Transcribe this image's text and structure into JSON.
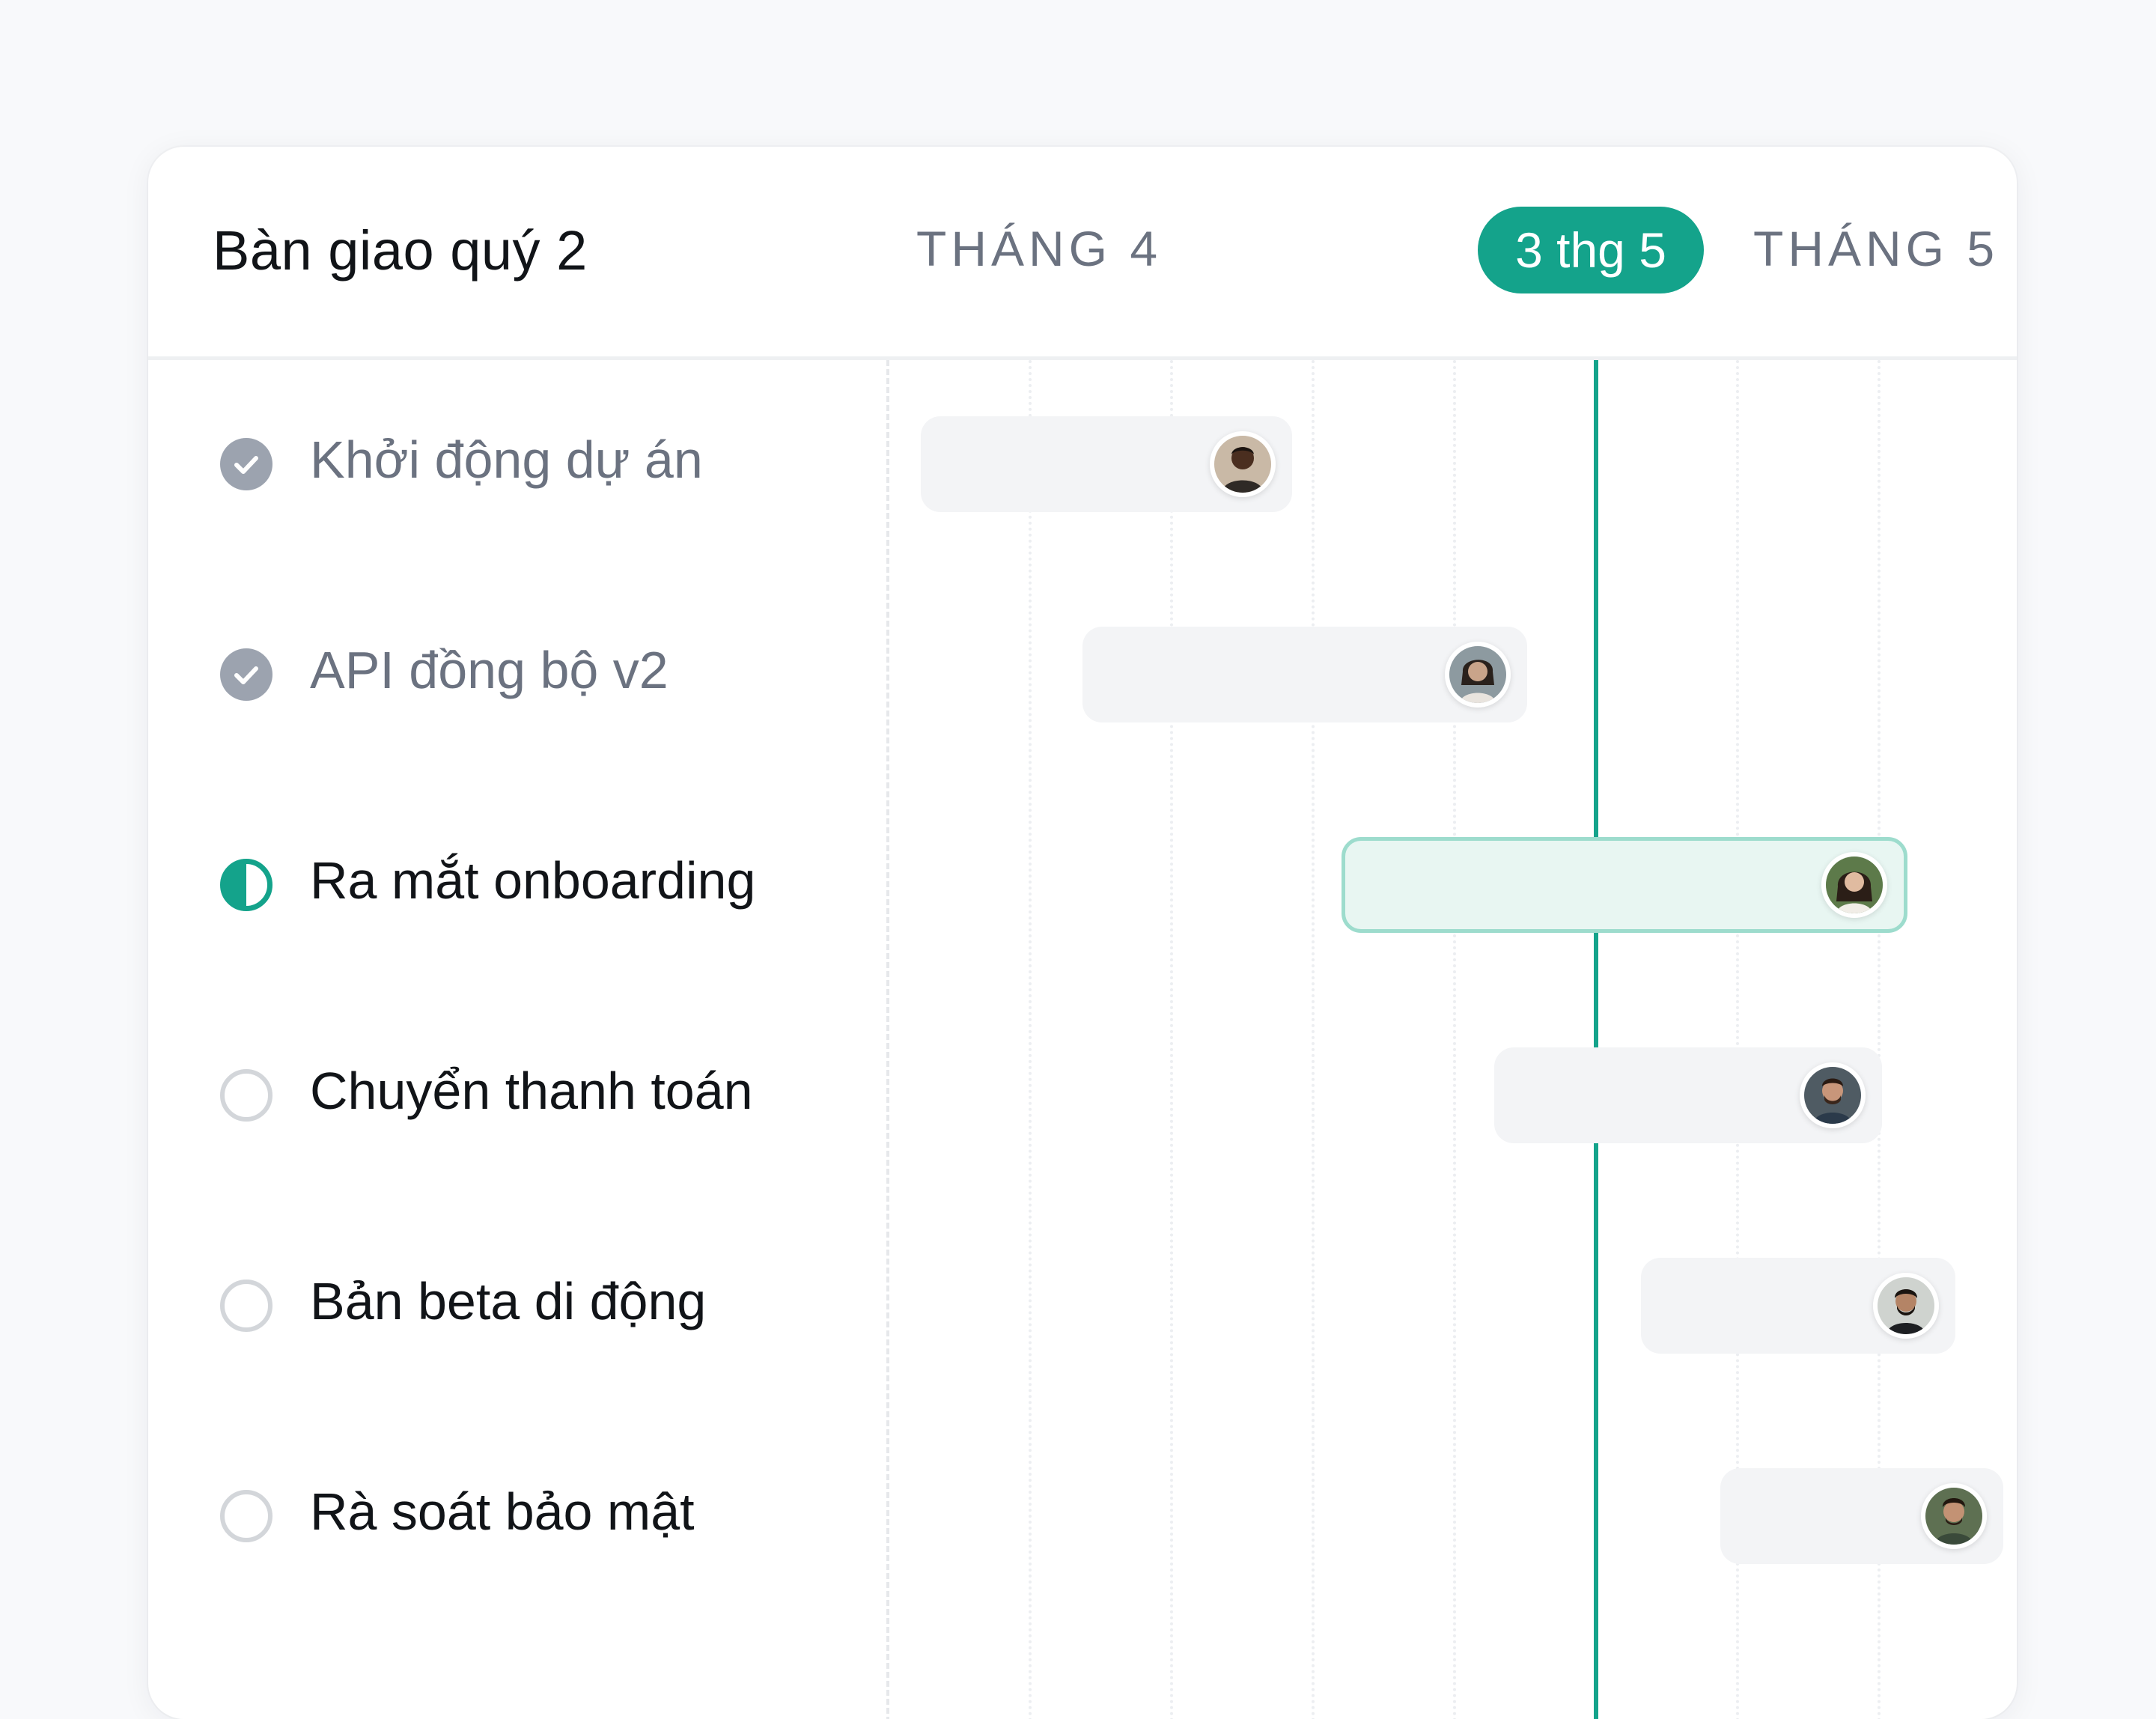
{
  "header": {
    "title": "Bàn giao quý 2",
    "months": [
      "THÁNG 4",
      "THÁNG 5"
    ],
    "today_label": "3 thg 5"
  },
  "colors": {
    "accent": "#14a38b",
    "bar": "#f3f4f6",
    "current_bar": "#e8f6f2",
    "done_status": "#9ca3af"
  },
  "tasks": [
    {
      "label": "Khởi động dự án",
      "status": "done",
      "avatar": "person-1-avatar"
    },
    {
      "label": "API đồng bộ v2",
      "status": "done",
      "avatar": "person-2-avatar"
    },
    {
      "label": "Ra mắt onboarding",
      "status": "in-progress",
      "avatar": "person-3-avatar"
    },
    {
      "label": "Chuyển thanh toán",
      "status": "todo",
      "avatar": "person-4-avatar"
    },
    {
      "label": "Bản beta di động",
      "status": "todo",
      "avatar": "person-5-avatar"
    },
    {
      "label": "Rà soát bảo mật",
      "status": "todo",
      "avatar": "person-6-avatar"
    }
  ]
}
